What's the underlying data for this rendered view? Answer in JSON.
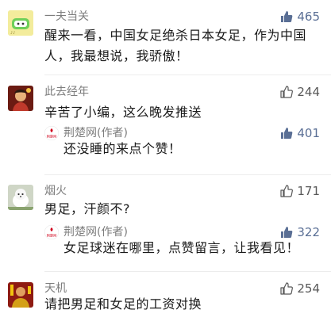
{
  "comments": [
    {
      "name": "一夫当关",
      "likes": "465",
      "liked": true,
      "avatar_icon": "green-cartoon-avatar",
      "text_lines": [
        "醒来一看，中国女足绝杀日本女足，作为中国",
        "人，我最想说，我骄傲！"
      ]
    },
    {
      "name": "此去经年",
      "likes": "244",
      "liked": false,
      "avatar_icon": "red-portrait-avatar",
      "text_lines": [
        "辛苦了小编，这么晚发推送"
      ],
      "reply": {
        "name": "荆楚网(作者)",
        "likes": "401",
        "liked": true,
        "avatar_icon": "jingchu-logo-avatar",
        "text": "还没睡的来点个赞！"
      }
    },
    {
      "name": "烟火",
      "likes": "171",
      "liked": false,
      "avatar_icon": "white-dog-avatar",
      "text_lines": [
        "男足，汗颜不?"
      ],
      "reply": {
        "name": "荆楚网(作者)",
        "likes": "322",
        "liked": true,
        "avatar_icon": "jingchu-logo-avatar",
        "text": "女足球迷在哪里，点赞留言，让我看见！"
      }
    },
    {
      "name": "天机",
      "likes": "254",
      "liked": false,
      "avatar_icon": "red-poster-avatar",
      "text_lines": [
        "请把男足和女足的工资对换"
      ]
    }
  ],
  "logo_text": "荆楚网",
  "colors": {
    "liked": "#5a6f95",
    "unliked": "#585858",
    "name": "#7d7d7d"
  }
}
